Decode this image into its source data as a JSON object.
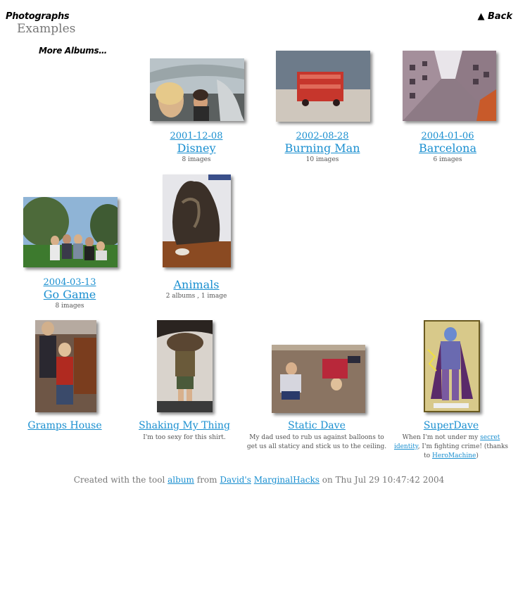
{
  "header": {
    "title": "Photographs",
    "subtitle": "Examples",
    "back_label": "▲ Back",
    "more_albums": "More Albums…"
  },
  "albums_row1": [
    {
      "date": "2001-12-08",
      "name": "Disney",
      "meta": "8 images"
    },
    {
      "date": "2002-08-28",
      "name": "Burning Man",
      "meta": "10 images"
    },
    {
      "date": "2004-01-06",
      "name": "Barcelona",
      "meta": "6 images"
    }
  ],
  "albums_row2": [
    {
      "date": "2004-03-13",
      "name": "Go Game",
      "meta": "8 images"
    },
    {
      "name": "Animals",
      "meta": "2 albums , 1 image"
    }
  ],
  "images": [
    {
      "name": "Gramps House",
      "desc": ""
    },
    {
      "name": "Shaking My Thing",
      "desc": "I'm too sexy for this shirt."
    },
    {
      "name": "Static Dave",
      "desc": "My dad used to rub us against balloons to get us all staticy and stick us to the ceiling."
    },
    {
      "name": "SuperDave",
      "desc_pre": "When I'm not under my ",
      "desc_link1": "secret identity",
      "desc_mid": ", I'm fighting crime! (thanks to ",
      "desc_link2": "HeroMachine",
      "desc_post": ")"
    }
  ],
  "footer": {
    "pre": "Created with the tool ",
    "link_album": "album",
    "from": " from ",
    "link_david": "David's",
    "space": " ",
    "link_marginal": "MarginalHacks",
    "post": " on Thu Jul 29 10:47:42 2004"
  }
}
